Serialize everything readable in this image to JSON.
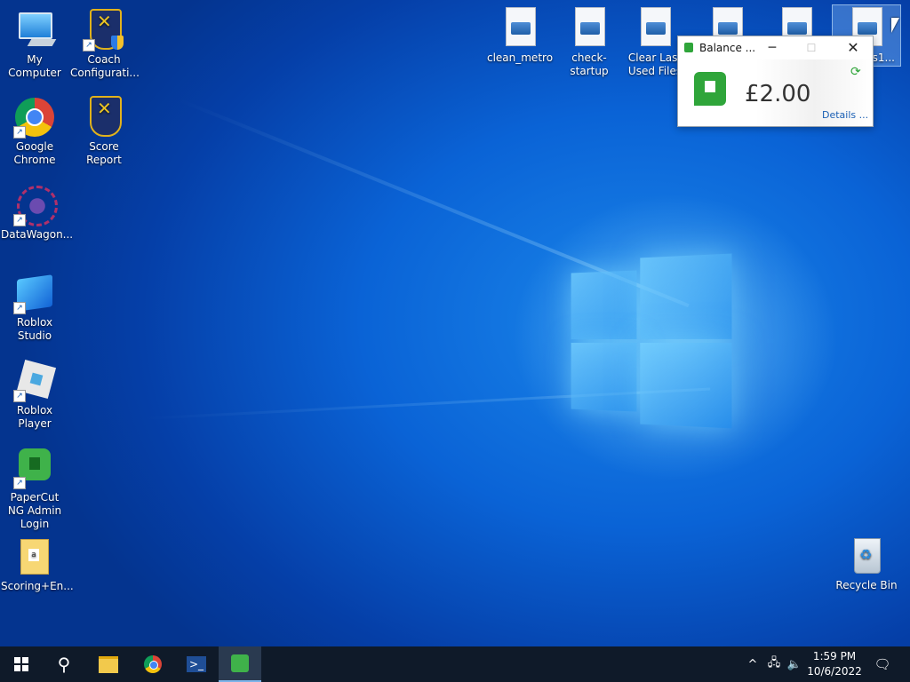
{
  "desktop": {
    "icons_left": [
      {
        "label": "My Computer"
      },
      {
        "label": "Coach Configurati..."
      },
      {
        "label": "Google Chrome"
      },
      {
        "label": "Score Report"
      },
      {
        "label": "DataWagon..."
      },
      {
        "label": "Roblox Studio"
      },
      {
        "label": "Roblox Player"
      },
      {
        "label": "PaperCut NG Admin Login"
      },
      {
        "label": "Scoring+En..."
      }
    ],
    "icons_top": [
      {
        "label": "clean_metro"
      },
      {
        "label": "check-startup"
      },
      {
        "label": "Clear Last Used Files"
      },
      {
        "label": ""
      },
      {
        "label": ""
      },
      {
        "label": "ws1..."
      }
    ],
    "recycle_bin": {
      "label": "Recycle Bin"
    }
  },
  "balance_window": {
    "title": "Balance ...",
    "amount": "£2.00",
    "details_link": "Details ...",
    "minimize_glyph": "─",
    "maximize_glyph": "☐",
    "close_glyph": "✕",
    "refresh_glyph": "⟳",
    "accent_color": "#2fa53a"
  },
  "taskbar": {
    "search_glyph": "⚲",
    "powershell_glyph": ">_",
    "tray": {
      "chevron_glyph": "^",
      "network_glyph": "🖧",
      "volume_glyph": "🔈",
      "notifications_glyph": "🗨"
    },
    "clock": {
      "time": "1:59 PM",
      "date": "10/6/2022"
    },
    "active_item": "papercut"
  }
}
